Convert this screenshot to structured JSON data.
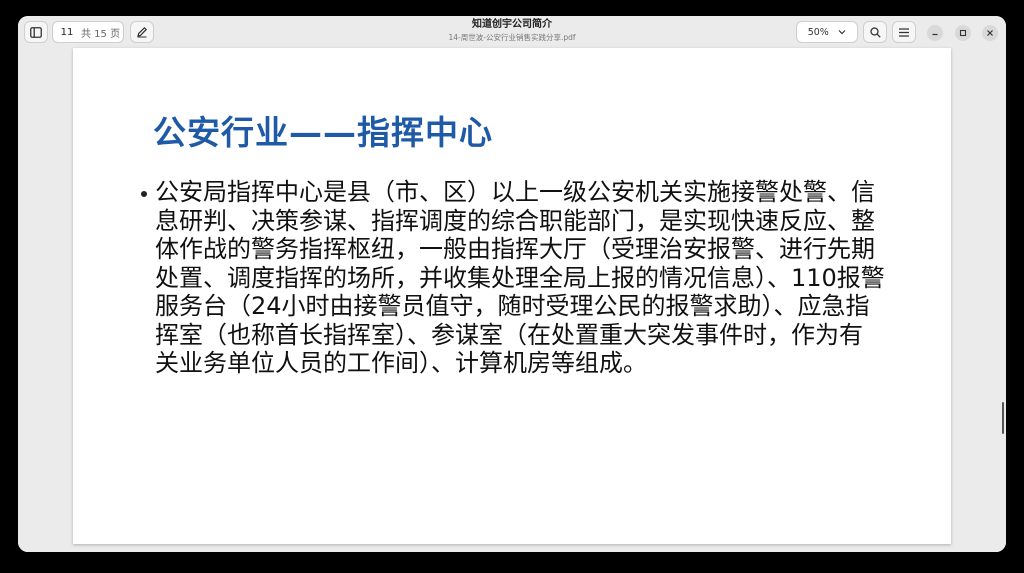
{
  "header": {
    "title": "知道创宇公司简介",
    "subtitle": "14-周世波-公安行业销售实践分享.pdf",
    "page_current": "11",
    "page_total": "共 15 页",
    "zoom": "50%"
  },
  "icons": {
    "sidebar": "sidebar-toggle-icon",
    "annotate": "pencil-icon",
    "search": "search-icon",
    "menu": "hamburger-menu-icon",
    "zoom": "chevron-down-icon",
    "minimize": "minimize-icon",
    "maximize": "maximize-icon",
    "close": "close-icon"
  },
  "slide": {
    "title": "公安行业——指挥中心",
    "body": "公安局指挥中心是县（市、区）以上一级公安机关实施接警处警、信息研判、决策参谋、指挥调度的综合职能部门，是实现快速反应、整体作战的警务指挥枢纽，一般由指挥大厅（受理治安报警、进行先期处置、调度指挥的场所，并收集处理全局上报的情况信息）、110报警服务台（24小时由接警员值守，随时受理公民的报警求助）、应急指挥室（也称首长指挥室）、参谋室（在处置重大突发事件时，作为有关业务单位人员的工作间）、计算机房等组成。"
  },
  "colors": {
    "title": "#1f5aa6",
    "body": "#111111",
    "window_bg": "#ebebeb"
  }
}
